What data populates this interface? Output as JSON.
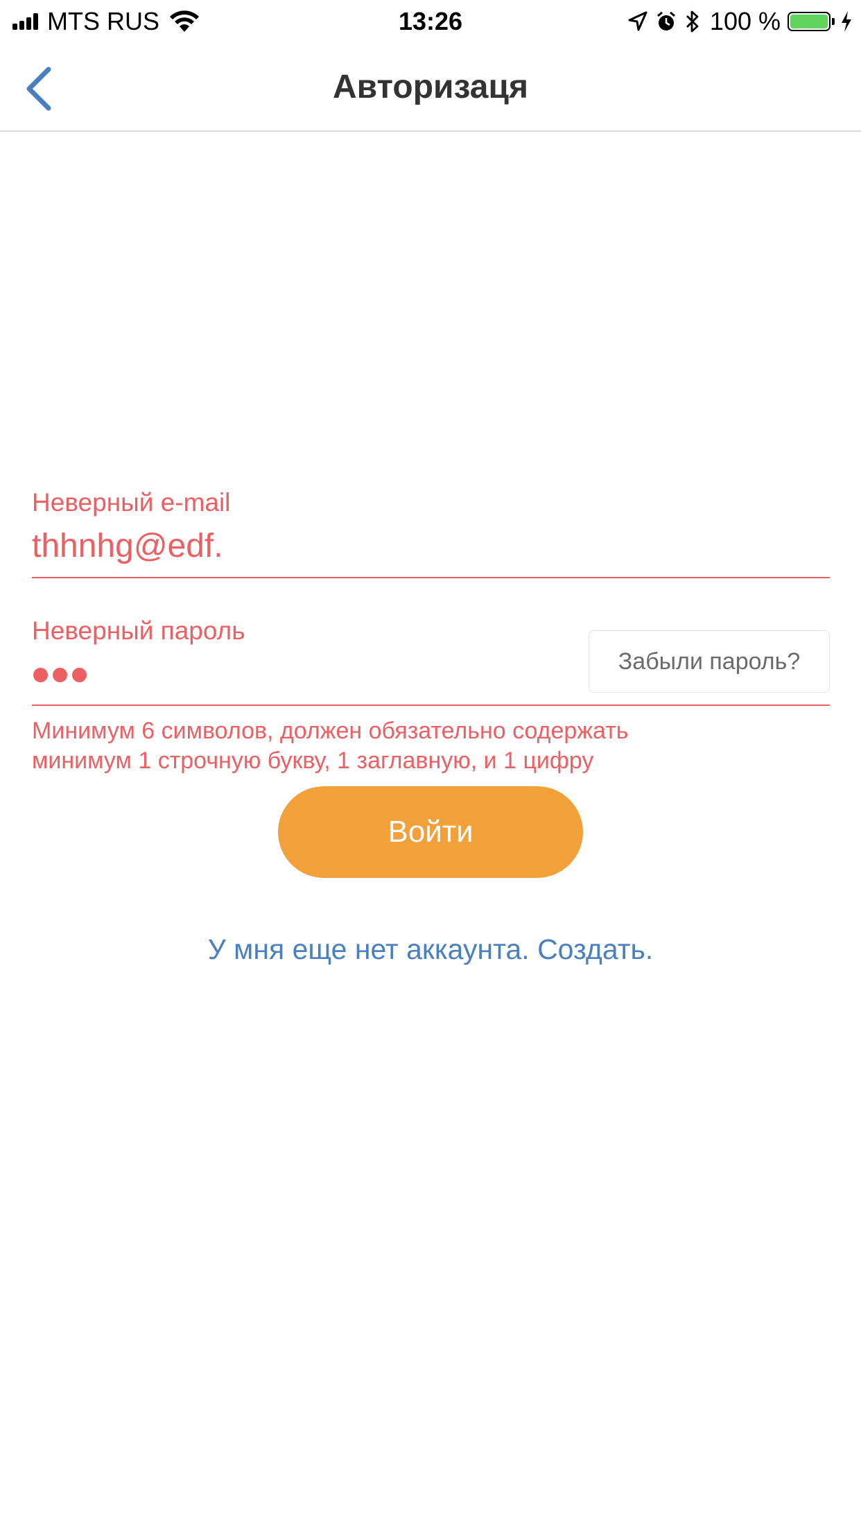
{
  "status_bar": {
    "carrier": "MTS RUS",
    "time": "13:26",
    "battery_percent_text": "100 %",
    "battery_level": 1.0,
    "icons": [
      "signal-icon",
      "wifi-icon",
      "location-icon",
      "alarm-icon",
      "bluetooth-icon",
      "battery-icon",
      "charging-icon"
    ]
  },
  "nav": {
    "title": "Авторизаця",
    "back_icon": "chevron-left-icon",
    "accent_color": "#4a7fc0"
  },
  "form": {
    "email": {
      "label": "Неверный e-mail",
      "value": "thhnhg@edf."
    },
    "password": {
      "label": "Неверный пароль",
      "masked_length": 3,
      "forgot_label": "Забыли пароль?"
    },
    "hint_line1": "Минимум 6 символов, должен обязательно содержать",
    "hint_line2": "минимум 1 строчную букву, 1 заглавную, и 1 цифру",
    "error_color": "#ec5f63"
  },
  "actions": {
    "login_label": "Войти",
    "login_color": "#f2a03a",
    "create_account_label": "У мня еще нет аккаунта. Создать."
  }
}
